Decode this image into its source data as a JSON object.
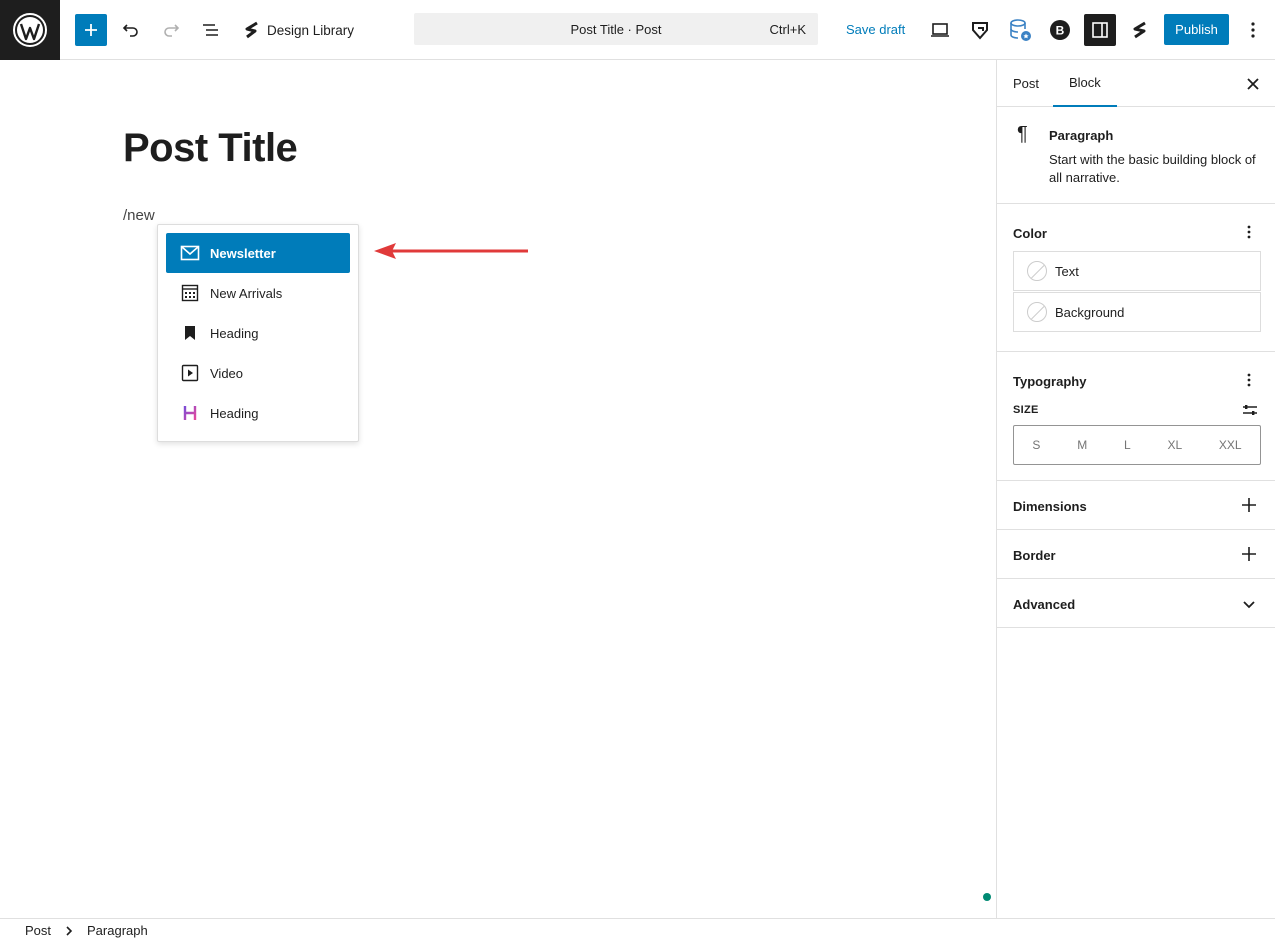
{
  "toolbar": {
    "design_library_label": "Design Library",
    "document_title": "Post Title · Post",
    "shortcut": "Ctrl+K",
    "save_draft_label": "Save draft",
    "publish_label": "Publish"
  },
  "editor": {
    "post_title": "Post Title",
    "paragraph_text": "/new",
    "autocomplete": [
      {
        "label": "Newsletter",
        "icon": "envelope-icon",
        "selected": true
      },
      {
        "label": "New Arrivals",
        "icon": "calendar-grid-icon",
        "selected": false
      },
      {
        "label": "Heading",
        "icon": "bookmark-icon",
        "selected": false
      },
      {
        "label": "Video",
        "icon": "play-icon",
        "selected": false
      },
      {
        "label": "Heading",
        "icon": "h-letter-icon",
        "selected": false
      }
    ]
  },
  "sidebar": {
    "tabs": [
      "Post",
      "Block"
    ],
    "active_tab": "Block",
    "block": {
      "title": "Paragraph",
      "description": "Start with the basic building block of all narrative."
    },
    "color": {
      "title": "Color",
      "items": [
        "Text",
        "Background"
      ]
    },
    "typography": {
      "title": "Typography",
      "size_label": "SIZE",
      "sizes": [
        "S",
        "M",
        "L",
        "XL",
        "XXL"
      ]
    },
    "dimensions_title": "Dimensions",
    "border_title": "Border",
    "advanced_title": "Advanced"
  },
  "footer": {
    "breadcrumb": [
      "Post",
      "Paragraph"
    ]
  },
  "colors": {
    "accent": "#007cba",
    "dark": "#1e1e1e",
    "arrow": "#e03a3a"
  }
}
